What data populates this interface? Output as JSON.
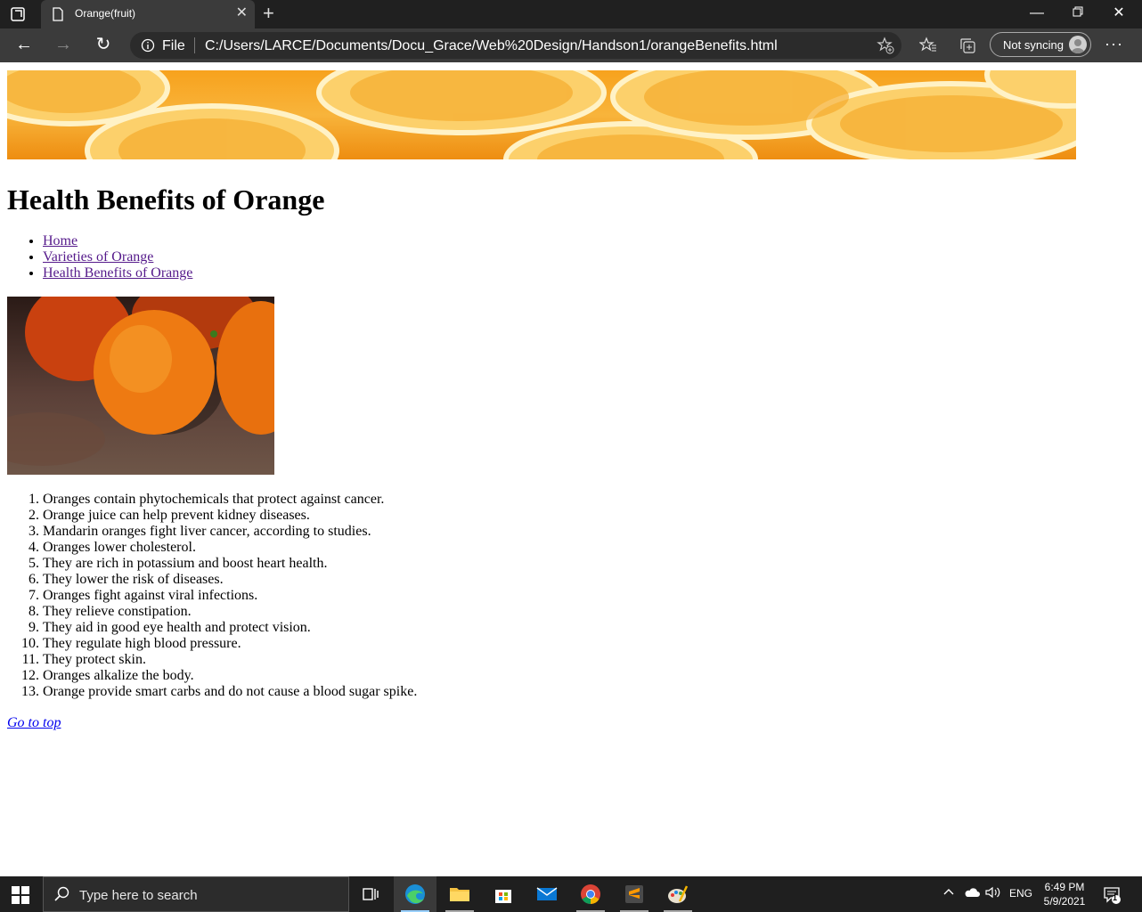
{
  "browser": {
    "tab_title": "Orange(fruit)",
    "address_scheme_label": "File",
    "address_url": "C:/Users/LARCE/Documents/Docu_Grace/Web%20Design/Handson1/orangeBenefits.html",
    "sync_label": "Not syncing",
    "icons": [
      "tab-actions-icon",
      "page-icon",
      "close-icon",
      "plus-icon",
      "minimize-icon",
      "restore-icon",
      "window-close-icon",
      "back-icon",
      "forward-icon",
      "refresh-icon",
      "info-icon",
      "add-favorite-icon",
      "favorites-icon",
      "collections-icon",
      "profile-avatar",
      "more-icon"
    ]
  },
  "page": {
    "heading": "Health Benefits of Orange",
    "nav_links": [
      "Home",
      "Varieties of Orange",
      "Health Benefits of Orange"
    ],
    "benefits": [
      "Oranges contain phytochemicals that protect against cancer.",
      "Orange juice can help prevent kidney diseases.",
      "Mandarin oranges fight liver cancer, according to studies.",
      "Oranges lower cholesterol.",
      "They are rich in potassium and boost heart health.",
      "They lower the risk of diseases.",
      "Oranges fight against viral infections.",
      "They relieve constipation.",
      "They aid in good eye health and protect vision.",
      "They regulate high blood pressure.",
      "They protect skin.",
      "Oranges alkalize the body.",
      "Orange provide smart carbs and do not cause a blood sugar spike."
    ],
    "go_top_label": "Go to top"
  },
  "taskbar": {
    "search_placeholder": "Type here to search",
    "language": "ENG",
    "time": "6:49 PM",
    "date": "5/9/2021",
    "notification_count": "1",
    "apps": [
      "task-view-icon",
      "edge-icon",
      "file-explorer-icon",
      "store-icon",
      "mail-icon",
      "chrome-icon",
      "sublime-icon",
      "paint-icon"
    ]
  },
  "colors": {
    "chrome_dark": "#202020",
    "toolbar": "#3b3b3b",
    "visited_link": "#551a8b",
    "link": "#0000ee",
    "orange": "#f7a21d"
  }
}
